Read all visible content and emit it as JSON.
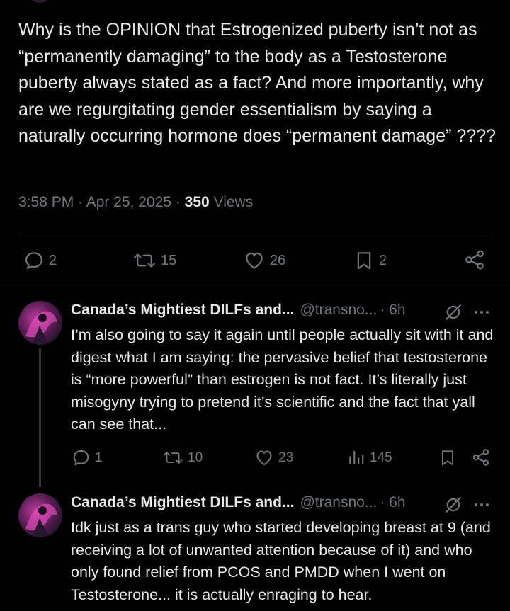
{
  "post": {
    "text": "Why is the OPINION that Estrogenized puberty isn’t not as “permanently damaging” to the body as a Testosterone puberty always stated as a fact? And more importantly, why are we regurgitating gender essentialism by saying a naturally occurring hormone does “permanent damage” ????",
    "time": "3:58 PM",
    "date": "Apr 25, 2025",
    "views_count": "350",
    "views_label": "Views",
    "replies": "2",
    "reposts": "15",
    "likes": "26",
    "bookmarks": "2"
  },
  "replies": [
    {
      "name": "Canada’s Mightiest DILFs and...",
      "handle": "@transno...",
      "time": "· 6h",
      "text": "I’m also going to say it again until people actually sit with it and digest what I am saying: the pervasive belief that testosterone is “more powerful” than estrogen is not fact. It’s literally just misogyny trying to pretend it’s scientific and the fact that yall can see that...",
      "replies": "1",
      "reposts": "10",
      "likes": "23",
      "views": "145"
    },
    {
      "name": "Canada’s Mightiest DILFs and...",
      "handle": "@transno...",
      "time": "· 6h",
      "text": "Idk just as a trans guy who started developing breast at 9 (and receiving a lot of unwanted attention because of it) and who only found relief from PCOS and PMDD when I went on Testosterone... it is actually enraging to hear."
    }
  ],
  "icons": {
    "reply": "comment-icon",
    "repost": "repost-icon",
    "like": "heart-icon",
    "bookmark": "bookmark-icon",
    "share": "share-icon",
    "views": "views-chart-icon",
    "grok": "grok-icon",
    "more": "more-icon"
  },
  "colors": {
    "background": "#000000",
    "text": "#e7e9ea",
    "muted": "#71767b",
    "divider": "#2f3336"
  }
}
